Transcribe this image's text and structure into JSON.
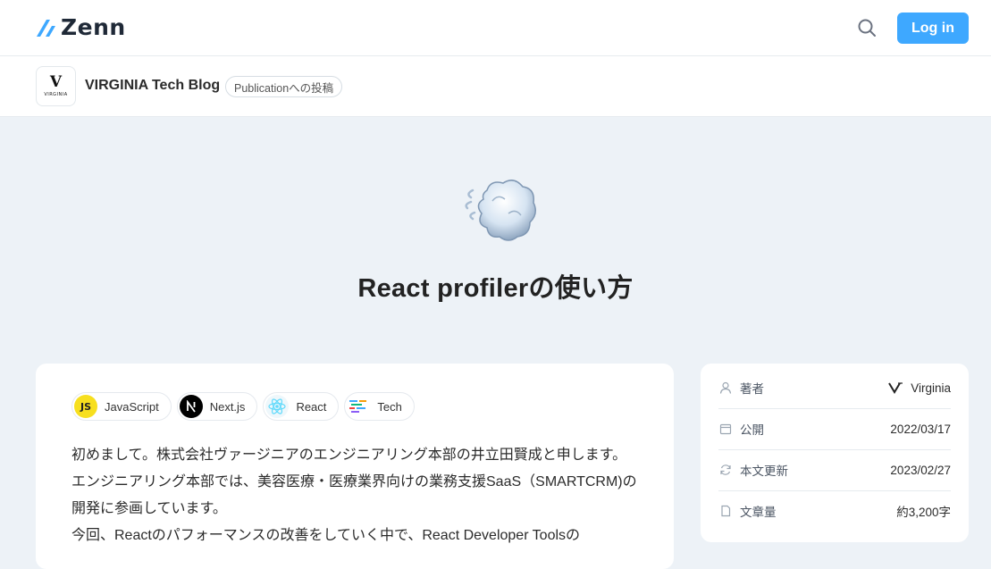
{
  "header": {
    "logo_text": "Zenn",
    "login_label": "Log in",
    "brand_color": "#3ea8ff"
  },
  "publication": {
    "name": "VIRGINIA Tech Blog",
    "badge": "Publicationへの投稿",
    "avatar_mark": "V",
    "avatar_word": "VIRGINIA"
  },
  "article": {
    "emoji": "dashing-cloud",
    "title": "React profilerの使い方",
    "topics": [
      {
        "label": "JavaScript",
        "icon": "js-icon"
      },
      {
        "label": "Next.js",
        "icon": "nextjs-icon"
      },
      {
        "label": "React",
        "icon": "react-icon"
      },
      {
        "label": "Tech",
        "icon": "tech-icon"
      }
    ],
    "paragraphs": [
      "初めまして。株式会社ヴァージニアのエンジニアリング本部の井立田賢成と申します。",
      "エンジニアリング本部では、美容医療・医療業界向けの業務支援SaaS（SMARTCRM)の",
      "開発に参画しています。",
      "今回、Reactのパフォーマンスの改善をしていく中で、React Developer Toolsの"
    ]
  },
  "info": {
    "author_label": "著者",
    "author_value": "Virginia",
    "published_label": "公開",
    "published_value": "2022/03/17",
    "updated_label": "本文更新",
    "updated_value": "2023/02/27",
    "length_label": "文章量",
    "length_value": "約3,200字"
  }
}
